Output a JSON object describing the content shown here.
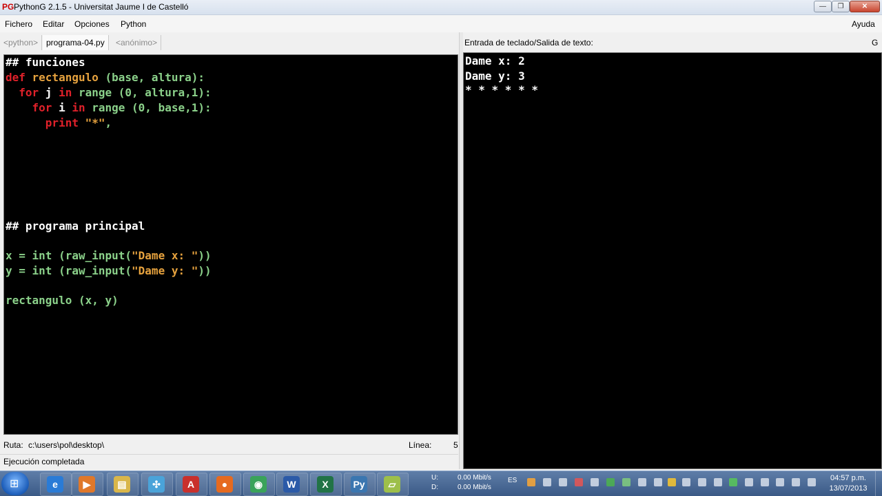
{
  "window": {
    "title": "PythonG 2.1.5 - Universitat Jaume I de Castelló",
    "app_icon": "PG",
    "controls": {
      "minimize": "—",
      "maximize": "❐",
      "close": "✕"
    }
  },
  "menu": {
    "items": [
      "Fichero",
      "Editar",
      "Opciones",
      "Python"
    ],
    "help": "Ayuda"
  },
  "tabs": [
    {
      "label": "<python>",
      "active": false
    },
    {
      "label": "programa-04.py",
      "active": true
    },
    {
      "label": "<anónimo>",
      "active": false
    }
  ],
  "editor": {
    "lines": [
      [
        {
          "t": "## funciones",
          "c": "white"
        }
      ],
      [
        {
          "t": "def ",
          "c": "red"
        },
        {
          "t": "rectangulo",
          "c": "gold"
        },
        {
          "t": " (base, altura):",
          "c": "green"
        }
      ],
      [
        {
          "t": "  for ",
          "c": "red"
        },
        {
          "t": "j ",
          "c": "white"
        },
        {
          "t": "in ",
          "c": "red"
        },
        {
          "t": "range (0, altura,1):",
          "c": "green"
        }
      ],
      [
        {
          "t": "    for ",
          "c": "red"
        },
        {
          "t": "i ",
          "c": "white"
        },
        {
          "t": "in ",
          "c": "red"
        },
        {
          "t": "range (0, base,1):",
          "c": "green"
        }
      ],
      [
        {
          "t": "      print ",
          "c": "red"
        },
        {
          "t": "\"*\"",
          "c": "gold"
        },
        {
          "t": ",",
          "c": "green"
        }
      ],
      [
        {
          "t": "## programa principal",
          "c": "white"
        }
      ],
      [
        {
          "t": "x = int (raw_input(",
          "c": "green"
        },
        {
          "t": "\"Dame x: \"",
          "c": "gold"
        },
        {
          "t": "))",
          "c": "green"
        }
      ],
      [
        {
          "t": "y = int (raw_input(",
          "c": "green"
        },
        {
          "t": "\"Dame y: \"",
          "c": "gold"
        },
        {
          "t": "))",
          "c": "green"
        }
      ],
      [
        {
          "t": "rectangulo (x, y)",
          "c": "green"
        }
      ]
    ]
  },
  "output": {
    "label": "Entrada de teclado/Salida de texto:",
    "extra": "G",
    "lines": [
      "Dame x: 2",
      "Dame y: 3",
      "* * * * * *"
    ]
  },
  "status": {
    "ruta_label": "Ruta:",
    "ruta_value": "c:\\users\\pol\\desktop\\",
    "linea_label": "Línea:",
    "linea_value": "5",
    "message": "Ejecución completada"
  },
  "taskbar": {
    "start": "⊞",
    "apps": [
      {
        "name": "internet-explorer",
        "glyph": "e",
        "color": "#2a7bd6"
      },
      {
        "name": "media-player",
        "glyph": "▶",
        "color": "#e0782a"
      },
      {
        "name": "file-explorer",
        "glyph": "▤",
        "color": "#d9b64a"
      },
      {
        "name": "network-tool",
        "glyph": "✣",
        "color": "#4aa3d9"
      },
      {
        "name": "acrobat-reader",
        "glyph": "A",
        "color": "#c9302c"
      },
      {
        "name": "firefox",
        "glyph": "●",
        "color": "#e66a1f"
      },
      {
        "name": "chrome",
        "glyph": "◉",
        "color": "#3aa35a"
      },
      {
        "name": "word",
        "glyph": "W",
        "color": "#2b5aa8"
      },
      {
        "name": "excel",
        "glyph": "X",
        "color": "#217346"
      },
      {
        "name": "python",
        "glyph": "Py",
        "color": "#3b76b0"
      },
      {
        "name": "document",
        "glyph": "▱",
        "color": "#9dbf4a"
      }
    ],
    "network": {
      "up_label": "U:",
      "down_label": "D:",
      "up": "0.00 Mbit/s",
      "down": "0.00 Mbit/s"
    },
    "language": "ES",
    "clock": {
      "time": "04:57 p.m.",
      "date": "13/07/2013"
    }
  }
}
